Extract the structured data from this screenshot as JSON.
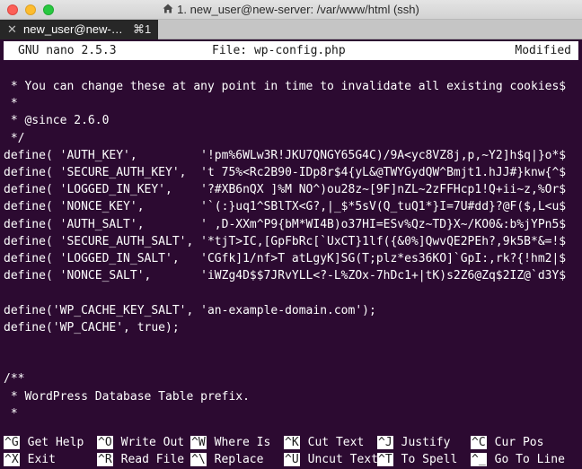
{
  "window": {
    "title": "1. new_user@new-server: /var/www/html (ssh)",
    "title_icon": "home-icon"
  },
  "tabs": [
    {
      "label": "new_user@new-serv…",
      "shortcut": "⌘1",
      "close": "✕"
    }
  ],
  "nano": {
    "version": "GNU nano 2.5.3",
    "file": "File: wp-config.php",
    "status": "Modified"
  },
  "content_lines": [
    " * You can change these at any point in time to invalidate all existing cookies$",
    " *",
    " * @since 2.6.0",
    " */",
    "define( 'AUTH_KEY',         '!pm%6WLw3R!JKU7QNGY65G4C)/9A<yc8VZ8j,p,~Y2]h$q|}o*$",
    "define( 'SECURE_AUTH_KEY',  't 75%<Rc2B90-IDp8r$4{yL&@TWYGydQW^Bmjt1.hJJ#}knw{^$",
    "define( 'LOGGED_IN_KEY',    '?#XB6nQX ]%M NO^)ou28z~[9F]nZL~2zFFHcp1!Q+ii~z,%Or$",
    "define( 'NONCE_KEY',        '`(:}uq1^SBlTX<G?,|_$*5sV(Q_tuQ1*}I=7U#dd}?@F($,L<u$",
    "define( 'AUTH_SALT',        ' ,D-XXm^P9{bM*WI4B)o37HI=ESv%Qz~TD}X~/KO0&:b%jYPn5$",
    "define( 'SECURE_AUTH_SALT', '*tjT>IC,[GpFbRc[`UxCT}1lf({&0%]QwvQE2PEh?,9k5B*&=!$",
    "define( 'LOGGED_IN_SALT',   'CGfk]1/nf>T atLgyK]SG(T;plz*es36KO]`GpI:,rk?{!hm2|$",
    "define( 'NONCE_SALT',       'iWZg4D$$7JRvYLL<?-L%ZOx-7hDc1+|tK)s2Z6@Zq$2IZ@`d3Y$",
    "",
    "define('WP_CACHE_KEY_SALT', 'an-example-domain.com');",
    "define('WP_CACHE', true);",
    "",
    "",
    "/**",
    " * WordPress Database Table prefix.",
    " *"
  ],
  "shortcuts": [
    [
      {
        "key": "^G",
        "label": "Get Help"
      },
      {
        "key": "^O",
        "label": "Write Out"
      },
      {
        "key": "^W",
        "label": "Where Is"
      },
      {
        "key": "^K",
        "label": "Cut Text"
      },
      {
        "key": "^J",
        "label": "Justify"
      },
      {
        "key": "^C",
        "label": "Cur Pos"
      }
    ],
    [
      {
        "key": "^X",
        "label": "Exit"
      },
      {
        "key": "^R",
        "label": "Read File"
      },
      {
        "key": "^\\",
        "label": "Replace"
      },
      {
        "key": "^U",
        "label": "Uncut Text"
      },
      {
        "key": "^T",
        "label": "To Spell"
      },
      {
        "key": "^_",
        "label": "Go To Line"
      }
    ]
  ],
  "colors": {
    "terminal_bg": "#2c0a31",
    "terminal_fg": "#ffffff",
    "header_bg": "#ffffff",
    "close_button": "#fc5f57",
    "minimize_button": "#fdbc2e",
    "maximize_button": "#28c840"
  }
}
